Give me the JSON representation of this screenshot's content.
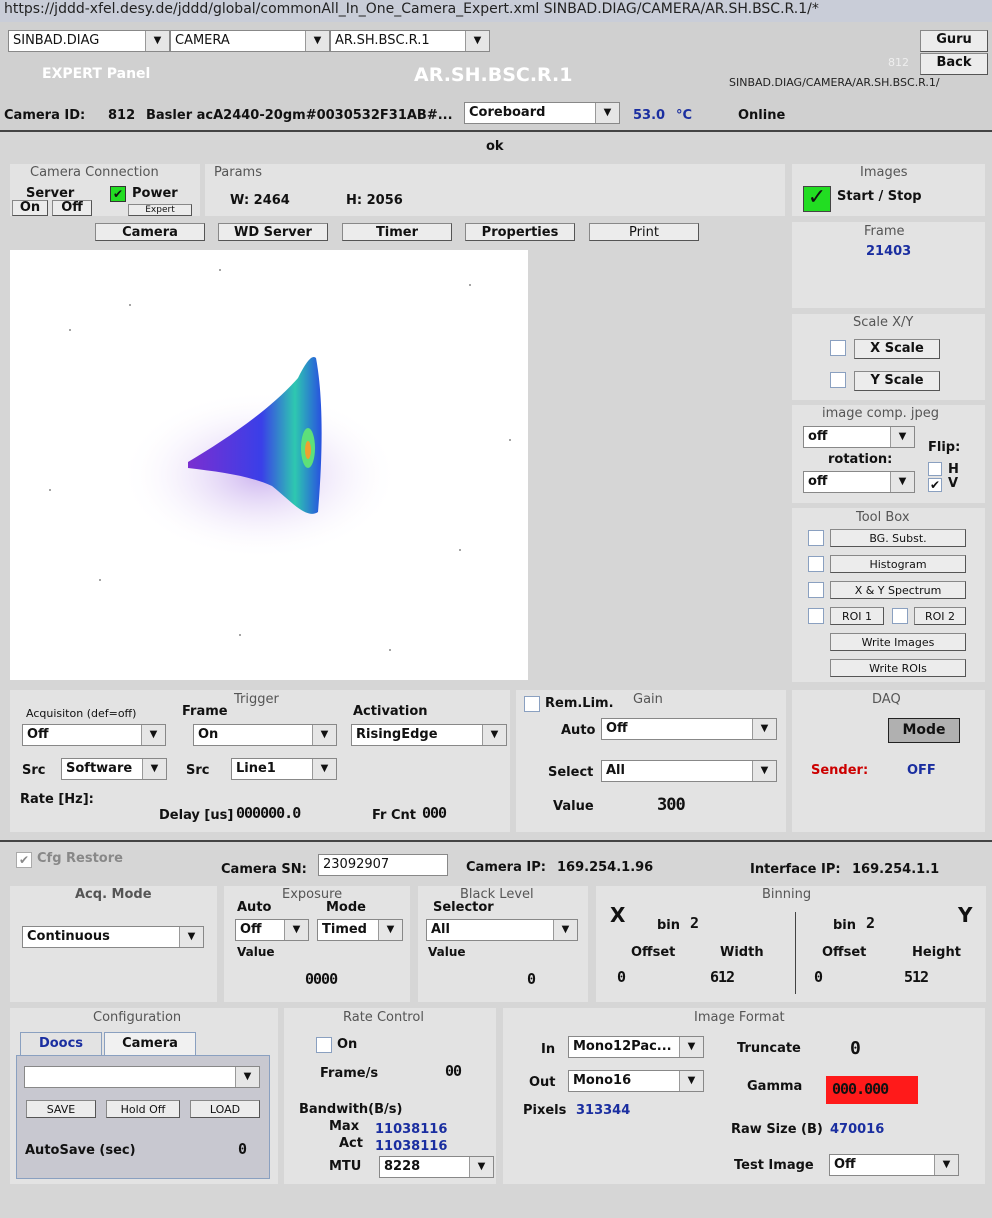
{
  "url": "https://jddd-xfel.desy.de/jddd/global/commonAll_In_One_Camera_Expert.xml   SINBAD.DIAG/CAMERA/AR.SH.BSC.R.1/*",
  "header": {
    "facility": "SINBAD.DIAG",
    "device_class": "CAMERA",
    "device": "AR.SH.BSC.R.1",
    "guru": "Guru",
    "back": "Back",
    "num": "812",
    "panel": "EXPERT Panel",
    "title": "AR.SH.BSC.R.1",
    "path": "SINBAD.DIAG/CAMERA/AR.SH.BSC.R.1/"
  },
  "camrow": {
    "id_label": "Camera ID:",
    "id": "812",
    "model": "Basler acA2440-20gm#0030532F31AB#...",
    "sensor": "Coreboard",
    "temp": "53.0",
    "unit": "°C",
    "status": "Online"
  },
  "status_msg": "ok",
  "conn": {
    "title": "Camera Connection",
    "server": "Server",
    "on": "On",
    "off": "Off",
    "power": "Power",
    "expert": "Expert"
  },
  "params": {
    "title": "Params",
    "w": "W: 2464",
    "h": "H: 2056"
  },
  "tabs": [
    "Camera",
    "WD Server",
    "Timer",
    "Properties",
    "Print"
  ],
  "images": {
    "title": "Images",
    "start_stop": "Start / Stop"
  },
  "frame": {
    "title": "Frame",
    "value": "21403"
  },
  "scale": {
    "title": "Scale X/Y",
    "x": "X Scale",
    "y": "Y Scale"
  },
  "jpeg": {
    "title": "image comp. jpeg",
    "comp": "off",
    "rotation_label": "rotation:",
    "rotation": "off",
    "flip": "Flip:",
    "h": "H",
    "v": "V"
  },
  "toolbox": {
    "title": "Tool Box",
    "bg": "BG. Subst.",
    "hist": "Histogram",
    "spec": "X & Y Spectrum",
    "roi1": "ROI 1",
    "roi2": "ROI 2",
    "wimg": "Write Images",
    "wroi": "Write ROIs"
  },
  "trigger": {
    "title": "Trigger",
    "acq_label": "Acquisiton (def=off)",
    "acq": "Off",
    "frame_label": "Frame",
    "frame": "On",
    "act_label": "Activation",
    "act": "RisingEdge",
    "src": "Src",
    "src1": "Software",
    "src2": "Line1",
    "rate": "Rate [Hz]:",
    "delay": "Delay [us]",
    "delay_val": "000000.0",
    "frcnt": "Fr Cnt",
    "frcnt_val": "000"
  },
  "gain": {
    "remlim": "Rem.Lim.",
    "title": "Gain",
    "auto": "Auto",
    "auto_val": "Off",
    "select": "Select",
    "select_val": "All",
    "value": "Value",
    "value_val": "300"
  },
  "daq": {
    "title": "DAQ",
    "mode": "Mode",
    "sender": "Sender:",
    "state": "OFF"
  },
  "cfg": {
    "restore": "Cfg Restore",
    "sn_label": "Camera SN:",
    "sn": "23092907",
    "ip_label": "Camera IP:",
    "ip": "169.254.1.96",
    "iface_label": "Interface IP:",
    "iface": "169.254.1.1"
  },
  "acq": {
    "title": "Acq. Mode",
    "value": "Continuous"
  },
  "exposure": {
    "title": "Exposure",
    "auto": "Auto",
    "mode": "Mode",
    "auto_val": "Off",
    "mode_val": "Timed",
    "value": "Value",
    "value_val": "0000"
  },
  "black": {
    "title": "Black Level",
    "selector": "Selector",
    "sel_val": "All",
    "value": "Value",
    "value_val": "0"
  },
  "binning": {
    "title": "Binning",
    "x": "X",
    "y": "Y",
    "bin": "bin",
    "offset": "Offset",
    "width": "Width",
    "height": "Height",
    "bx": "2",
    "by": "2",
    "w": "612",
    "h": "512",
    "ox": "0",
    "oy": "0"
  },
  "config": {
    "title": "Configuration",
    "tab1": "Doocs",
    "tab2": "Camera",
    "save": "SAVE",
    "hold": "Hold Off",
    "load": "LOAD",
    "autosave": "AutoSave (sec)",
    "autosave_val": "0"
  },
  "rate": {
    "title": "Rate Control",
    "on": "On",
    "fps": "Frame/s",
    "fps_val": "00",
    "bw": "Bandwith(B/s)",
    "max": "Max",
    "max_val": "11038116",
    "act": "Act",
    "act_val": "11038116",
    "mtu": "MTU",
    "mtu_val": "8228"
  },
  "imgfmt": {
    "title": "Image Format",
    "in": "In",
    "in_val": "Mono12Pac...",
    "out": "Out",
    "out_val": "Mono16",
    "pixels": "Pixels",
    "pixels_val": "313344",
    "truncate": "Truncate",
    "trunc_val": "0",
    "gamma": "Gamma",
    "gamma_val": "000.000",
    "raw": "Raw Size (B)",
    "raw_val": "470016",
    "test": "Test Image",
    "test_val": "Off"
  },
  "colors": {
    "gamma_bg": "#ff1a1a",
    "start_green": "#22dd22",
    "sender_red": "#cc0000",
    "value_blue": "#1a2ea0"
  }
}
